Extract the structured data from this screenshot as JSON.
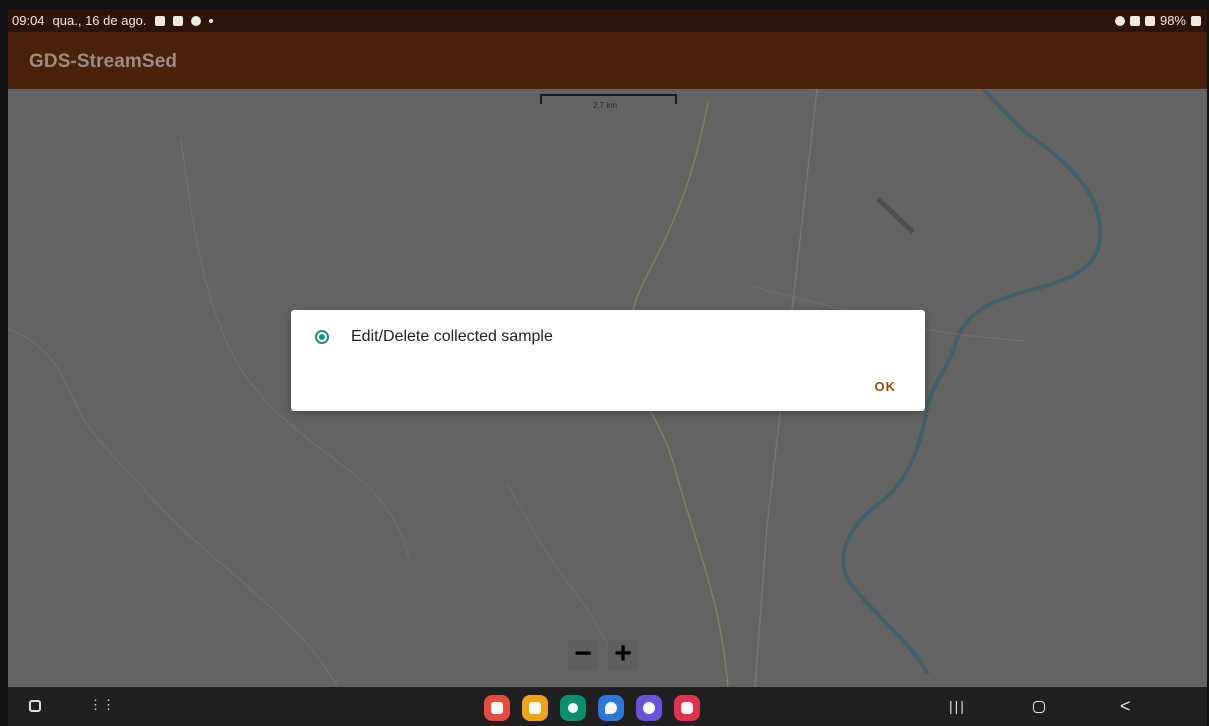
{
  "status_bar": {
    "time": "09:04",
    "date": "qua., 16 de ago.",
    "battery": "98%",
    "icons": {
      "gallery": "gallery-icon",
      "calendar": "calendar-icon",
      "cloud": "cloud-icon",
      "location": "location-icon",
      "wifi": "wifi-icon",
      "signal": "signal-icon",
      "battery": "battery-icon"
    }
  },
  "app": {
    "title": "GDS-StreamSed",
    "header_color": "#4a2109"
  },
  "map": {
    "scale_label": "2,7 km",
    "zoom_out_label": "−",
    "zoom_in_label": "+"
  },
  "dialog": {
    "option_label": "Edit/Delete collected sample",
    "option_selected": true,
    "ok_label": "OK",
    "accent_color": "#16927f"
  },
  "navigation": {
    "left_icons": [
      "app-switcher-icon",
      "apps-grid-icon"
    ],
    "dock_apps": [
      {
        "name": "notes-app",
        "color": "#e44c3b"
      },
      {
        "name": "files-app",
        "color": "#f0a21b"
      },
      {
        "name": "phone-app",
        "color": "#0e8e6a"
      },
      {
        "name": "messages-app",
        "color": "#2b79d8"
      },
      {
        "name": "browser-app",
        "color": "#6455d9"
      },
      {
        "name": "camera-app",
        "color": "#e0324d"
      }
    ],
    "recent_label": "|||",
    "back_label": "<"
  }
}
